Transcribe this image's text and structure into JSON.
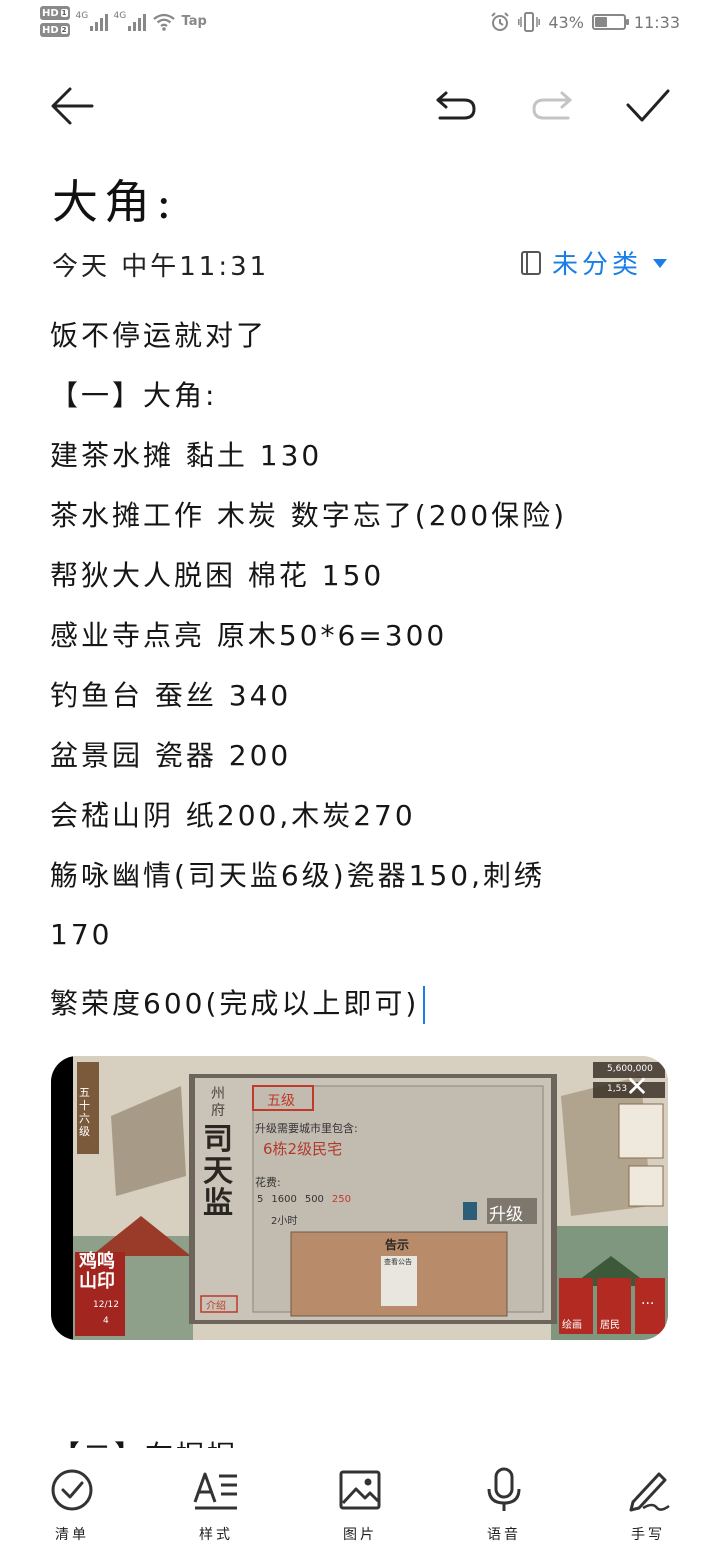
{
  "status_bar": {
    "hd1": "HD",
    "hd1_sub": "1",
    "hd2": "HD",
    "hd2_sub": "2",
    "net1": "4G",
    "net2": "4G",
    "tap": "Tap",
    "battery_percent": "43%",
    "battery_level": 0.43,
    "time": "11:33"
  },
  "toolbar": {
    "back_icon": "arrow-left-icon",
    "undo_icon": "undo-icon",
    "redo_icon": "redo-icon",
    "done_icon": "check-icon"
  },
  "note": {
    "title": "大角:",
    "date": "今天 中午11:31",
    "category": "未分类",
    "lines": [
      "饭不停运就对了",
      "【一】大角:",
      "建茶水摊 黏土 130",
      "茶水摊工作 木炭 数字忘了(200保险)",
      "帮狄大人脱困 棉花 150",
      "感业寺点亮 原木50*6=300",
      "钓鱼台 蚕丝 340",
      "盆景园 瓷器 200",
      "会嵇山阴 纸200,木炭270",
      "觞咏幽情(司天监6级)瓷器150,刺绣",
      "170",
      "繁荣度600(完成以上即可)"
    ],
    "next_line_partial": "【二】在据据"
  },
  "embed": {
    "level_badge": "五十六级",
    "building_category": "州府",
    "building_name": "司天监",
    "level": "五级",
    "requirement_label": "升级需要城市里包含:",
    "requirement": "6栋2级民宅",
    "cost_label": "花费:",
    "cost_1": "5",
    "cost_2": "1600",
    "cost_3": "500",
    "cost_4": "250",
    "time": "2小时",
    "upgrade_button": "升级",
    "notice_title": "告示",
    "notice_paper": "查看公告",
    "intro_button": "介绍",
    "coins": "5,600,000",
    "copper": "1,53",
    "stamp_text": "鸡鸣山印",
    "stamp_count": "12/12",
    "stamp_sub": "4",
    "btn_draw": "绘画",
    "btn_residents": "居民",
    "btn_more": "···"
  },
  "bottom_bar": {
    "items": [
      {
        "label": "清单",
        "icon": "checklist-icon"
      },
      {
        "label": "样式",
        "icon": "text-style-icon"
      },
      {
        "label": "图片",
        "icon": "image-icon"
      },
      {
        "label": "语音",
        "icon": "microphone-icon"
      },
      {
        "label": "手写",
        "icon": "handwriting-pen-icon"
      }
    ]
  },
  "colors": {
    "accent": "#1a7de8",
    "text": "#161616",
    "icon_gray": "#333333"
  }
}
